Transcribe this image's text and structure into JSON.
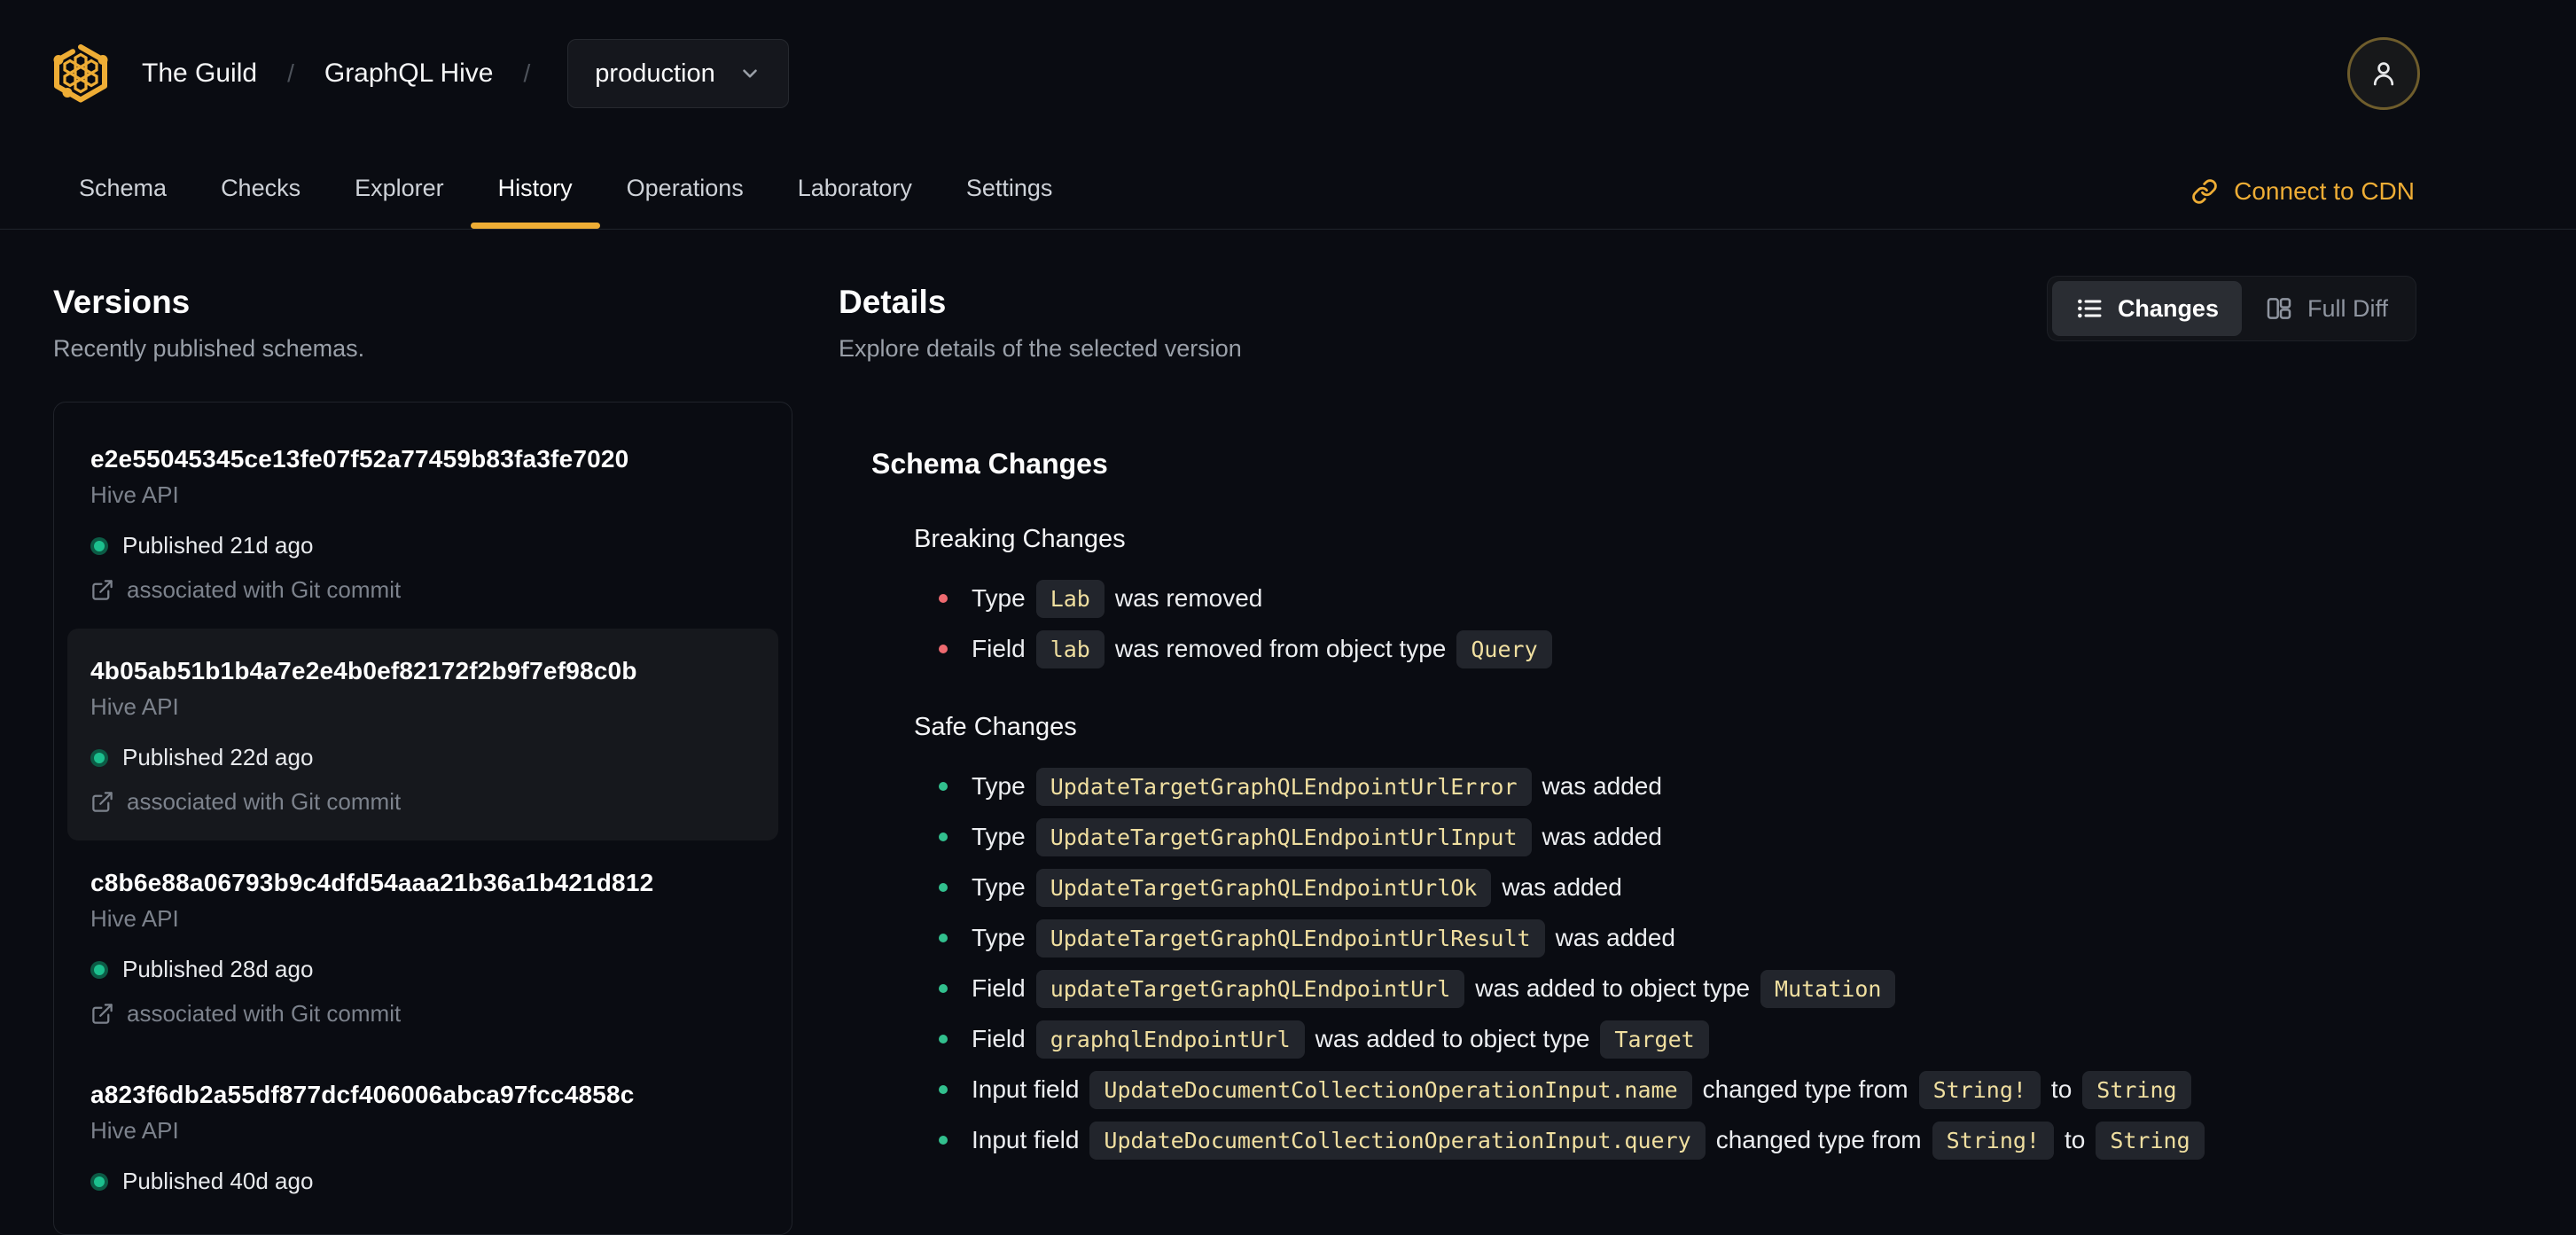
{
  "header": {
    "org": "The Guild",
    "project": "GraphQL Hive",
    "separator": "/",
    "env_select": {
      "value": "production",
      "icon": "chevron-down-icon"
    },
    "tabs": [
      {
        "label": "Schema",
        "active": false
      },
      {
        "label": "Checks",
        "active": false
      },
      {
        "label": "Explorer",
        "active": false
      },
      {
        "label": "History",
        "active": true
      },
      {
        "label": "Operations",
        "active": false
      },
      {
        "label": "Laboratory",
        "active": false
      },
      {
        "label": "Settings",
        "active": false
      }
    ],
    "cdn_link": {
      "label": "Connect to CDN",
      "icon": "link-icon"
    },
    "avatar_icon": "user-icon"
  },
  "versions_panel": {
    "title": "Versions",
    "subtitle": "Recently published schemas.",
    "items": [
      {
        "hash": "e2e55045345ce13fe07f52a77459b83fa3fe7020",
        "service": "Hive API",
        "status": "Published 21d ago",
        "git": "associated with Git commit",
        "selected": false
      },
      {
        "hash": "4b05ab51b1b4a7e2e4b0ef82172f2b9f7ef98c0b",
        "service": "Hive API",
        "status": "Published 22d ago",
        "git": "associated with Git commit",
        "selected": true
      },
      {
        "hash": "c8b6e88a06793b9c4dfd54aaa21b36a1b421d812",
        "service": "Hive API",
        "status": "Published 28d ago",
        "git": "associated with Git commit",
        "selected": false
      },
      {
        "hash": "a823f6db2a55df877dcf406006abca97fcc4858c",
        "service": "Hive API",
        "status": "Published 40d ago",
        "git": null,
        "selected": false
      }
    ]
  },
  "details_panel": {
    "title": "Details",
    "subtitle": "Explore details of the selected version",
    "view_toggle": [
      {
        "label": "Changes",
        "icon": "list-icon",
        "active": true
      },
      {
        "label": "Full Diff",
        "icon": "columns-icon",
        "active": false
      }
    ],
    "section_title": "Schema Changes",
    "groups": [
      {
        "title": "Breaking Changes",
        "severity": "breaking",
        "bullet_color": "#ee6a70",
        "changes": [
          [
            {
              "t": "text",
              "v": "Type"
            },
            {
              "t": "code",
              "v": "Lab"
            },
            {
              "t": "text",
              "v": "was removed"
            }
          ],
          [
            {
              "t": "text",
              "v": "Field"
            },
            {
              "t": "code",
              "v": "lab"
            },
            {
              "t": "text",
              "v": "was removed from object type"
            },
            {
              "t": "code",
              "v": "Query"
            }
          ]
        ]
      },
      {
        "title": "Safe Changes",
        "severity": "safe",
        "bullet_color": "#32c08e",
        "changes": [
          [
            {
              "t": "text",
              "v": "Type"
            },
            {
              "t": "code",
              "v": "UpdateTargetGraphQLEndpointUrlError"
            },
            {
              "t": "text",
              "v": "was added"
            }
          ],
          [
            {
              "t": "text",
              "v": "Type"
            },
            {
              "t": "code",
              "v": "UpdateTargetGraphQLEndpointUrlInput"
            },
            {
              "t": "text",
              "v": "was added"
            }
          ],
          [
            {
              "t": "text",
              "v": "Type"
            },
            {
              "t": "code",
              "v": "UpdateTargetGraphQLEndpointUrlOk"
            },
            {
              "t": "text",
              "v": "was added"
            }
          ],
          [
            {
              "t": "text",
              "v": "Type"
            },
            {
              "t": "code",
              "v": "UpdateTargetGraphQLEndpointUrlResult"
            },
            {
              "t": "text",
              "v": "was added"
            }
          ],
          [
            {
              "t": "text",
              "v": "Field"
            },
            {
              "t": "code",
              "v": "updateTargetGraphQLEndpointUrl"
            },
            {
              "t": "text",
              "v": "was added to object type"
            },
            {
              "t": "code",
              "v": "Mutation"
            }
          ],
          [
            {
              "t": "text",
              "v": "Field"
            },
            {
              "t": "code",
              "v": "graphqlEndpointUrl"
            },
            {
              "t": "text",
              "v": "was added to object type"
            },
            {
              "t": "code",
              "v": "Target"
            }
          ],
          [
            {
              "t": "text",
              "v": "Input field"
            },
            {
              "t": "code",
              "v": "UpdateDocumentCollectionOperationInput.name"
            },
            {
              "t": "text",
              "v": "changed type from"
            },
            {
              "t": "code",
              "v": "String!"
            },
            {
              "t": "text",
              "v": "to"
            },
            {
              "t": "code",
              "v": "String"
            }
          ],
          [
            {
              "t": "text",
              "v": "Input field"
            },
            {
              "t": "code",
              "v": "UpdateDocumentCollectionOperationInput.query"
            },
            {
              "t": "text",
              "v": "changed type from"
            },
            {
              "t": "code",
              "v": "String!"
            },
            {
              "t": "text",
              "v": "to"
            },
            {
              "t": "code",
              "v": "String"
            }
          ]
        ]
      }
    ]
  },
  "colors": {
    "accent_yellow": "#eead35",
    "published_green": "#1cc08e",
    "breaking_red": "#ee6a70",
    "safe_green": "#32c08e",
    "chip_text": "#f0dfa0",
    "background": "#0a0c12"
  }
}
